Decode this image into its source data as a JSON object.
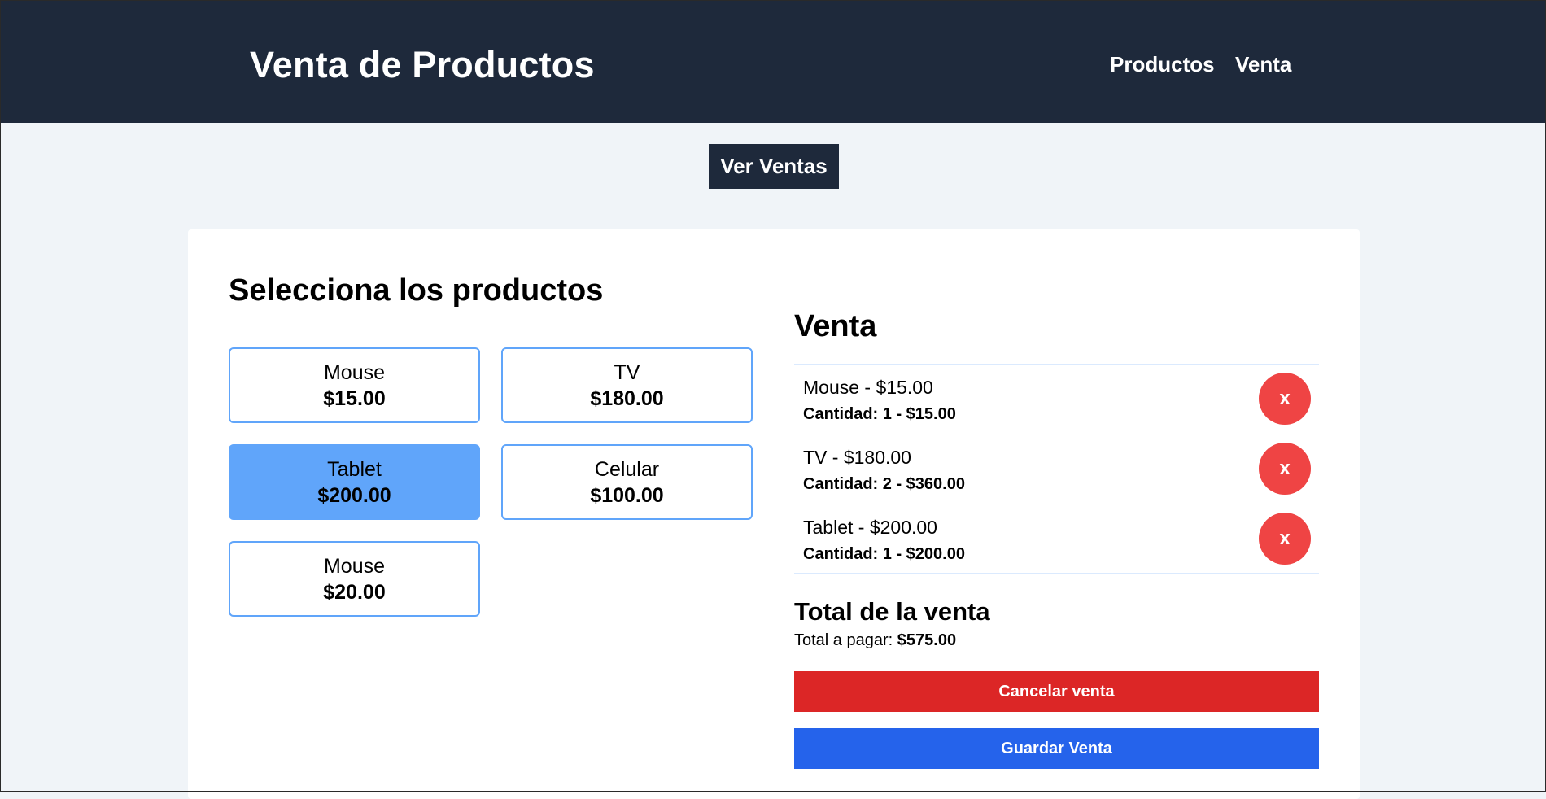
{
  "navbar": {
    "brand": "Venta de Productos",
    "links": [
      "Productos",
      "Venta"
    ]
  },
  "ver_ventas_label": "Ver Ventas",
  "products_section": {
    "title": "Selecciona los productos",
    "products": [
      {
        "name": "Mouse",
        "price": "$15.00",
        "selected": false
      },
      {
        "name": "TV",
        "price": "$180.00",
        "selected": false
      },
      {
        "name": "Tablet",
        "price": "$200.00",
        "selected": true
      },
      {
        "name": "Celular",
        "price": "$100.00",
        "selected": false
      },
      {
        "name": "Mouse",
        "price": "$20.00",
        "selected": false
      }
    ]
  },
  "sale": {
    "title": "Venta",
    "items": [
      {
        "line1": "Mouse - $15.00",
        "line2": "Cantidad: 1 - $15.00",
        "remove_label": "x"
      },
      {
        "line1": "TV - $180.00",
        "line2": "Cantidad: 2 - $360.00",
        "remove_label": "x"
      },
      {
        "line1": "Tablet - $200.00",
        "line2": "Cantidad: 1 - $200.00",
        "remove_label": "x"
      }
    ],
    "total_title": "Total de la venta",
    "total_label": "Total a pagar:",
    "total_value": "$575.00",
    "cancel_label": "Cancelar venta",
    "save_label": "Guardar Venta"
  },
  "colors": {
    "navbar": "#1e293b",
    "product_border": "#60a5fa",
    "product_selected": "#60a5fa",
    "remove": "#ef4444",
    "cancel": "#dc2626",
    "save": "#2563eb",
    "page_bg": "#f0f4f8"
  }
}
